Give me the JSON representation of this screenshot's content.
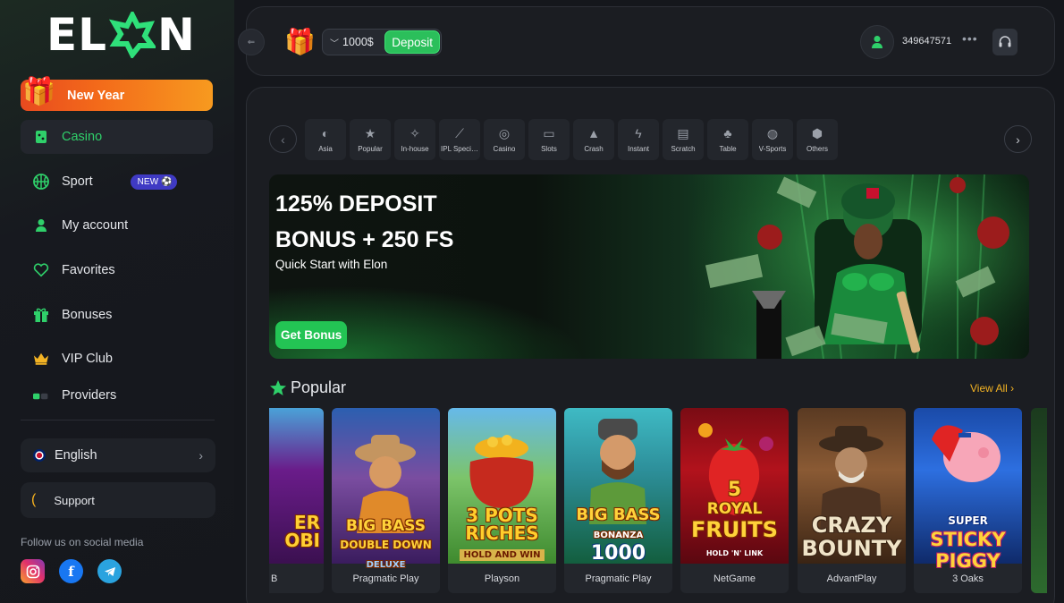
{
  "brand": {
    "logo_left": "EL",
    "logo_right": "N"
  },
  "sidebar": {
    "promo": {
      "label": "New Year",
      "icon": "gift-icon"
    },
    "items": [
      {
        "label": "Casino",
        "icon": "casino-icon",
        "active": true
      },
      {
        "label": "Sport",
        "icon": "sport-icon",
        "badge": "NEW"
      },
      {
        "label": "My account",
        "icon": "user-icon"
      },
      {
        "label": "Favorites",
        "icon": "heart-icon"
      },
      {
        "label": "Bonuses",
        "icon": "gift-icon"
      },
      {
        "label": "VIP Club",
        "icon": "crown-icon"
      },
      {
        "label": "Providers",
        "icon": "providers-icon"
      }
    ],
    "language": "English",
    "support": "Support",
    "social_title": "Follow us on social media"
  },
  "header": {
    "balance": "1000$",
    "deposit_label": "Deposit",
    "user_id": "349647571"
  },
  "categories": [
    {
      "label": "Asia",
      "icon": "asia-icon"
    },
    {
      "label": "Popular",
      "icon": "star-icon"
    },
    {
      "label": "In-house",
      "icon": "in-house-icon"
    },
    {
      "label": "IPL Speci…",
      "icon": "cricket-icon"
    },
    {
      "label": "Casino",
      "icon": "chip-icon"
    },
    {
      "label": "Slots",
      "icon": "slots-icon"
    },
    {
      "label": "Crash",
      "icon": "plane-icon"
    },
    {
      "label": "Instant",
      "icon": "lightning-icon"
    },
    {
      "label": "Scratch",
      "icon": "scratch-icon"
    },
    {
      "label": "Table",
      "icon": "table-icon"
    },
    {
      "label": "V-Sports",
      "icon": "gamepad-icon"
    },
    {
      "label": "Others",
      "icon": "box-icon"
    }
  ],
  "banner": {
    "title_line1": "125% DEPOSIT",
    "title_line2": "BONUS + 250 FS",
    "subtitle": "Quick Start with Elon",
    "button": "Get Bonus"
  },
  "popular": {
    "title": "Popular",
    "view_all": "View All",
    "games": [
      {
        "art_text": "ER\nOBI",
        "provider": "B"
      },
      {
        "art_text": "BIG BASS\nDOUBLE DOWN\nDELUXE",
        "provider": "Pragmatic Play"
      },
      {
        "art_text": "3 POTS\nRICHES\nHOLD AND WIN",
        "provider": "Playson"
      },
      {
        "art_text": "BIG BASS\nBONANZA\n1000",
        "provider": "Pragmatic Play"
      },
      {
        "art_text": "5\nROYAL\nFRUITS\nHOLD 'N' LINK",
        "provider": "NetGame"
      },
      {
        "art_text": "CRAZY\nBOUNTY",
        "provider": "AdvantPlay"
      },
      {
        "art_text": "SUPER\nSTICKY\nPIGGY",
        "provider": "3 Oaks"
      }
    ]
  },
  "colors": {
    "accent_green": "#2bbf5b",
    "promo_orange": "#f36a1a",
    "view_all_gold": "#f3b324",
    "badge_purple": "#3f3ac4"
  }
}
